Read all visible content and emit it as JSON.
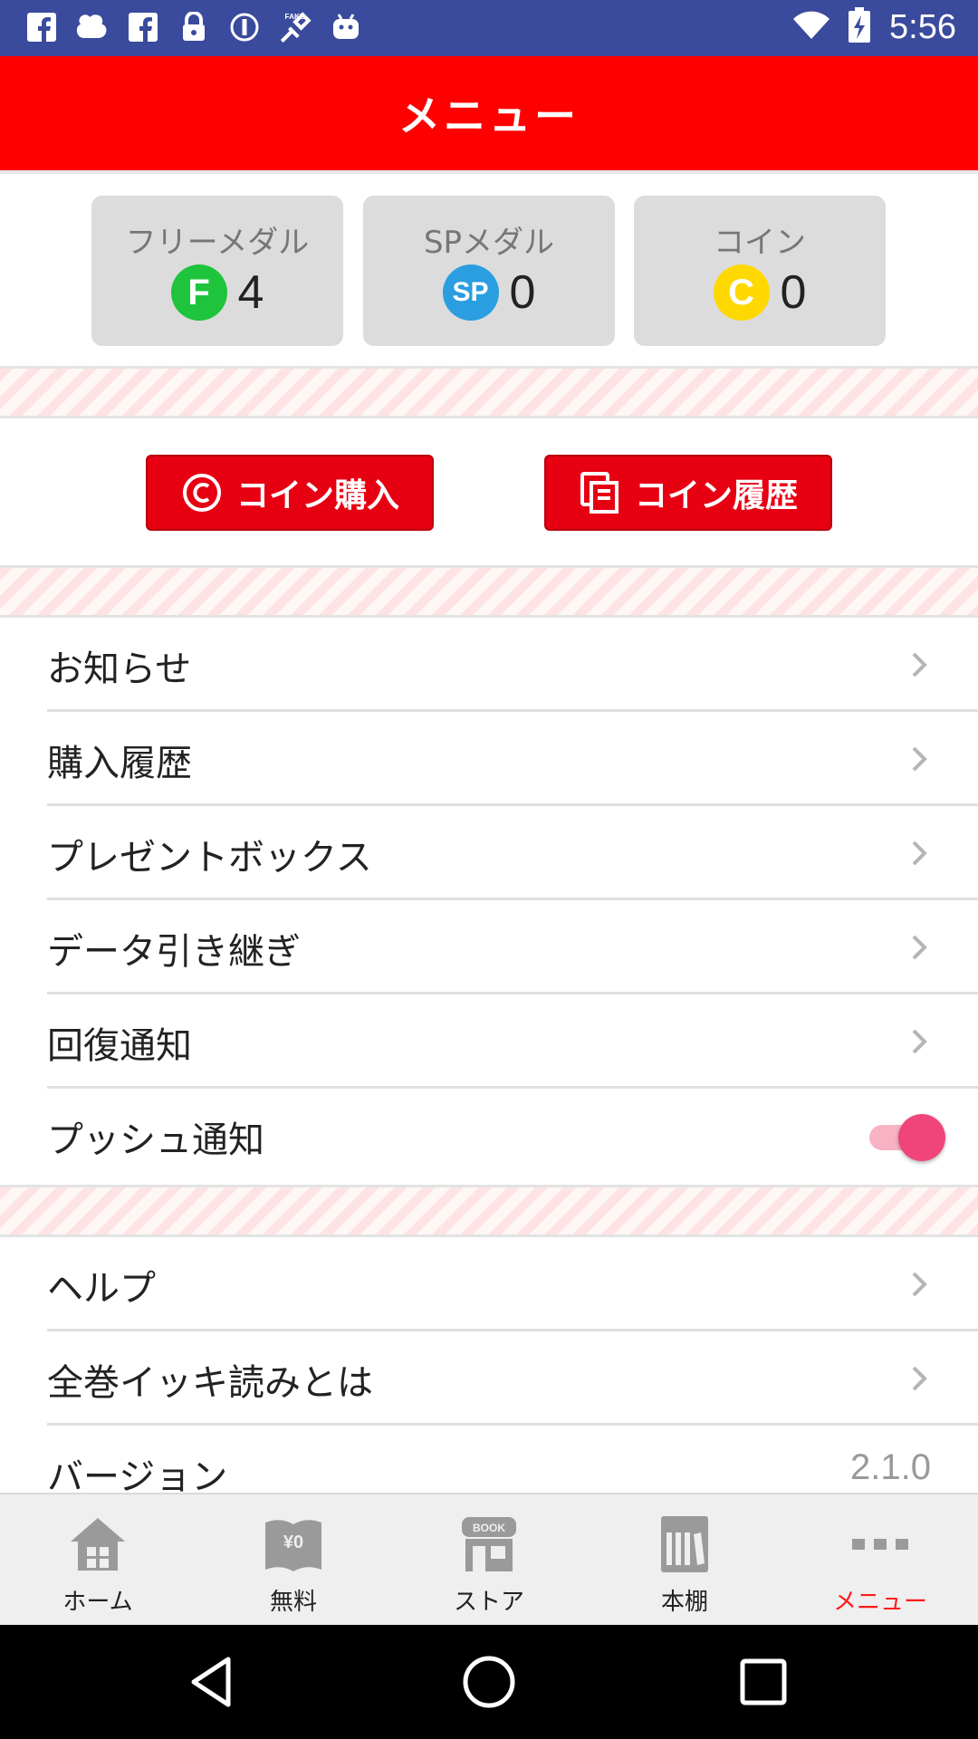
{
  "status_bar": {
    "time": "5:56",
    "icons": [
      "facebook-icon",
      "notification-icon",
      "facebook-icon",
      "lock-icon",
      "info-icon",
      "fake-gps-icon",
      "android-icon"
    ],
    "right_icons": [
      "wifi-icon",
      "battery-charging-icon"
    ]
  },
  "header": {
    "title": "メニュー"
  },
  "medals": [
    {
      "label": "フリーメダル",
      "badge": "F",
      "value": "4",
      "color": "#1ec43c"
    },
    {
      "label": "SPメダル",
      "badge": "SP",
      "value": "0",
      "color": "#2a9ee0"
    },
    {
      "label": "コイン",
      "badge": "C",
      "value": "0",
      "color": "#ffd800"
    }
  ],
  "coin_buttons": {
    "purchase": "コイン購入",
    "history": "コイン履歴"
  },
  "menu": {
    "items": [
      {
        "label": "お知らせ"
      },
      {
        "label": "購入履歴"
      },
      {
        "label": "プレゼントボックス"
      },
      {
        "label": "データ引き継ぎ"
      },
      {
        "label": "回復通知"
      }
    ],
    "push": {
      "label": "プッシュ通知",
      "enabled": true
    },
    "items2": [
      {
        "label": "ヘルプ"
      },
      {
        "label": "全巻イッキ読みとは"
      }
    ],
    "version": {
      "label": "バージョン",
      "value": "2.1.0"
    }
  },
  "bottom_nav": [
    {
      "label": "ホーム",
      "icon": "home-icon"
    },
    {
      "label": "無料",
      "icon": "free-book-icon"
    },
    {
      "label": "ストア",
      "icon": "store-icon"
    },
    {
      "label": "本棚",
      "icon": "bookshelf-icon"
    },
    {
      "label": "メニュー",
      "icon": "more-icon",
      "active": true
    }
  ],
  "colors": {
    "accent": "#ff0000",
    "status_bar": "#3a4a9c",
    "toggle_on": "#f0457a",
    "active_nav": "#ff1a1a"
  }
}
